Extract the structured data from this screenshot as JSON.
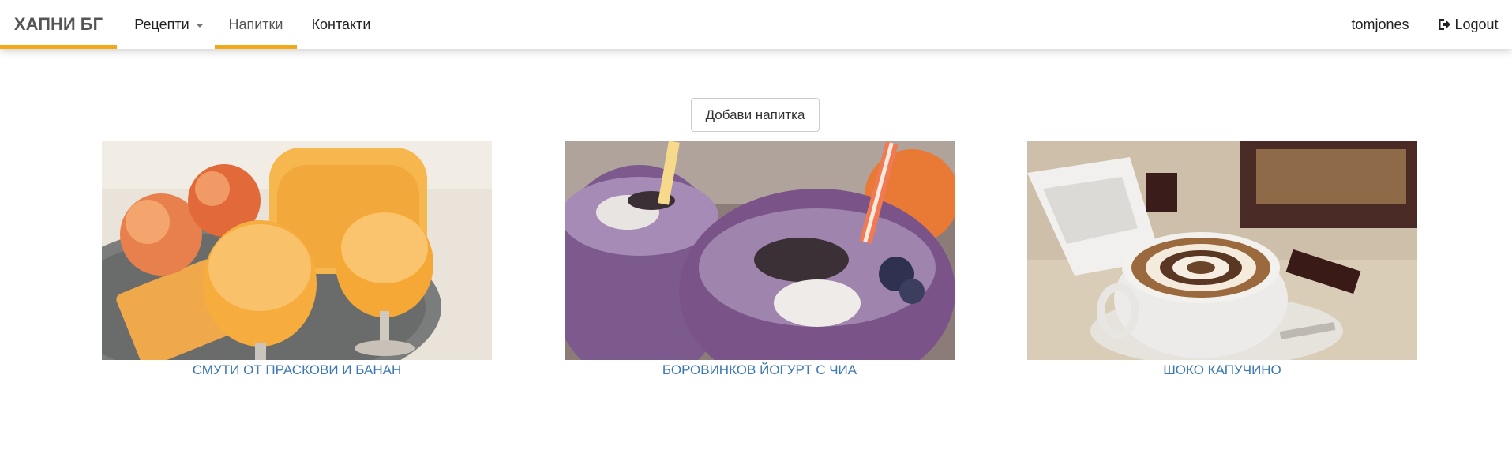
{
  "navbar": {
    "brand": "ХАПНИ БГ",
    "items": [
      {
        "label": "Рецепти",
        "has_dropdown": true,
        "active": false
      },
      {
        "label": "Напитки",
        "has_dropdown": false,
        "active": true
      },
      {
        "label": "Контакти",
        "has_dropdown": false,
        "active": false
      }
    ],
    "username": "tomjones",
    "logout_label": "Logout",
    "logout_icon": "sign-out-icon",
    "accent_color": "#f3a817"
  },
  "main": {
    "add_button_label": "Добави напитка",
    "drinks": [
      {
        "title": "СМУТИ ОТ ПРАСКОВИ И БАНАН",
        "image": "peach-smoothie-photo"
      },
      {
        "title": "БОРОВИНКОВ ЙОГУРТ С ЧИА",
        "image": "blueberry-chia-yogurt-photo"
      },
      {
        "title": "ШОКО КАПУЧИНО",
        "image": "choco-cappuccino-photo"
      }
    ],
    "link_color": "#3b77b5"
  }
}
